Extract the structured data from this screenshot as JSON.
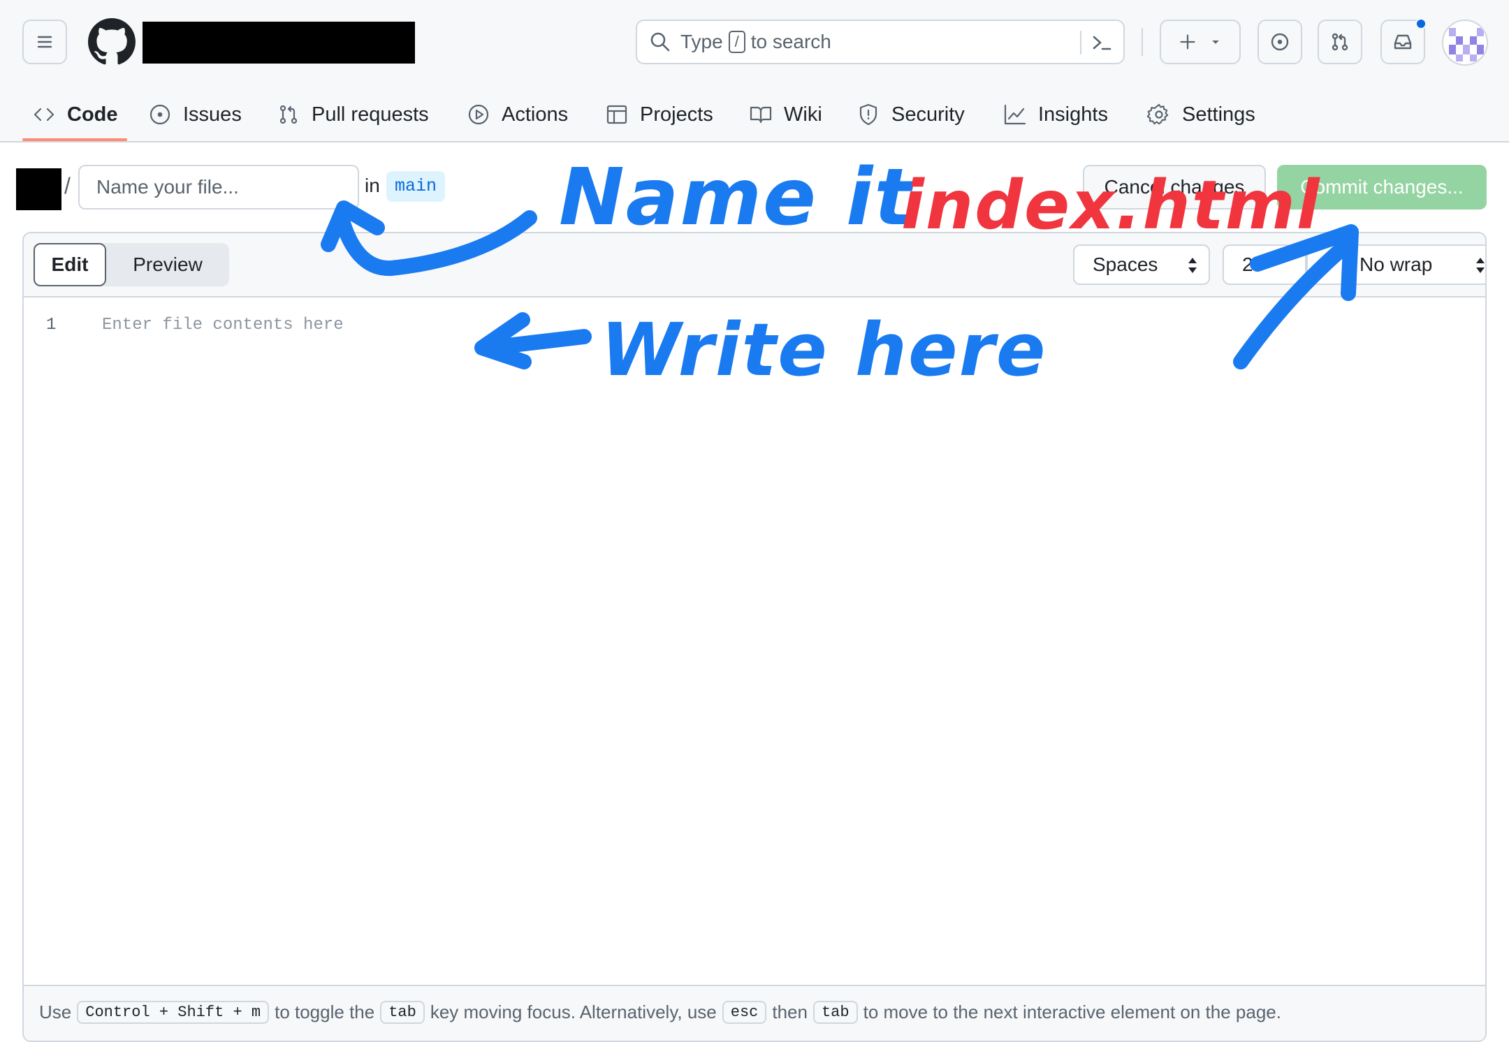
{
  "header": {
    "search_prefix": "Type",
    "search_slash": "/",
    "search_suffix": "to search"
  },
  "repo_nav": {
    "items": [
      {
        "label": "Code",
        "icon": "code-icon",
        "selected": true
      },
      {
        "label": "Issues",
        "icon": "issue-opened-icon"
      },
      {
        "label": "Pull requests",
        "icon": "git-pull-request-icon"
      },
      {
        "label": "Actions",
        "icon": "play-icon"
      },
      {
        "label": "Projects",
        "icon": "table-icon"
      },
      {
        "label": "Wiki",
        "icon": "book-icon"
      },
      {
        "label": "Security",
        "icon": "shield-icon"
      },
      {
        "label": "Insights",
        "icon": "graph-icon"
      },
      {
        "label": "Settings",
        "icon": "gear-icon"
      }
    ]
  },
  "file_path": {
    "separator": "/",
    "filename_placeholder": "Name your file...",
    "in_label": "in",
    "branch": "main"
  },
  "actions": {
    "cancel_label": "Cancel changes",
    "commit_label": "Commit changes..."
  },
  "editor": {
    "tab_edit": "Edit",
    "tab_preview": "Preview",
    "indent_mode": "Spaces",
    "indent_size": "2",
    "wrap_mode": "No wrap",
    "line_number": "1",
    "placeholder": "Enter file contents here",
    "footer": {
      "t1": "Use",
      "k1": "Control + Shift + m",
      "t2": "to toggle the",
      "k2": "tab",
      "t3": "key moving focus. Alternatively, use",
      "k3": "esc",
      "t4": "then",
      "k4": "tab",
      "t5": "to move to the next interactive element on the page."
    }
  },
  "annotations": {
    "name_it": "Name it",
    "filename": "index.html",
    "write_here": "Write here"
  },
  "colors": {
    "accent_blue": "#0969da",
    "commit_green_disabled": "#94d3a2",
    "annotation_blue": "#1a7af0",
    "annotation_red": "#f0353e",
    "tab_underline": "#fd8c73"
  }
}
